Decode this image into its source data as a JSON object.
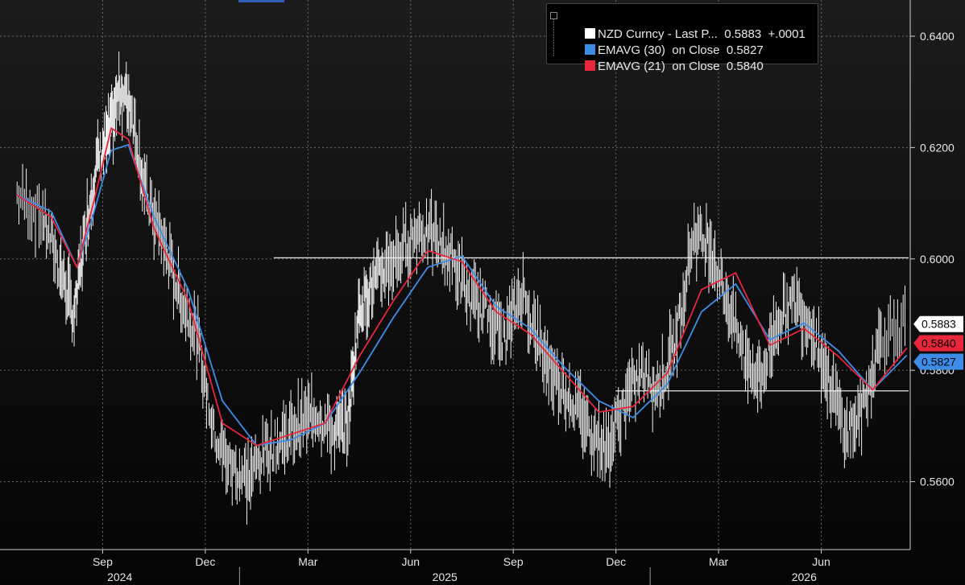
{
  "legend": {
    "rows": [
      {
        "name": "NZD Curncy - Last P...",
        "value": "0.5883",
        "change": "+.0001",
        "color": "#ffffff"
      },
      {
        "name": "EMAVG (30)  on Close",
        "value": "0.5827",
        "change": "",
        "color": "#3d8de8"
      },
      {
        "name": "EMAVG (21)  on Close",
        "value": "0.5840",
        "change": "",
        "color": "#e8263c"
      }
    ]
  },
  "price_tags": [
    {
      "label": "0.5883",
      "bg": "#ffffff",
      "fg": "#000000",
      "value": 0.5883
    },
    {
      "label": "0.5840",
      "bg": "#e8263c",
      "fg": "#000000",
      "value": 0.584
    },
    {
      "label": "0.5827",
      "bg": "#3d8de8",
      "fg": "#000000",
      "value": 0.5827
    }
  ],
  "chart_data": {
    "type": "line",
    "title": "",
    "xlabel": "",
    "ylabel": "",
    "ylim": [
      0.5478,
      0.6465
    ],
    "y_ticks": [
      "0.5600",
      "0.5800",
      "0.6000",
      "0.6200",
      "0.6400"
    ],
    "x_month_ticks": [
      "Sep",
      "Dec",
      "Mar",
      "Jun",
      "Sep",
      "Dec",
      "Mar",
      "Jun"
    ],
    "x_year_labels": [
      "2024",
      "2025",
      "2026"
    ],
    "grid": true,
    "legend_position": "top-right",
    "horizontal_lines": [
      {
        "y": 0.6002,
        "x_from": "2025-02",
        "x_to": "end"
      },
      {
        "y": 0.5763,
        "x_from": "2025-12",
        "x_to": "end"
      }
    ],
    "series": [
      {
        "name": "NZD Curncy - Last P...",
        "color": "#ffffff",
        "style": "high-low bars",
        "x": [
          "2024-06",
          "2024-07",
          "2024-07",
          "2024-08",
          "2024-08",
          "2024-08",
          "2024-09",
          "2024-09",
          "2024-09",
          "2024-10",
          "2024-10",
          "2024-11",
          "2024-11",
          "2024-12",
          "2024-12",
          "2025-01",
          "2025-01",
          "2025-02",
          "2025-02",
          "2025-03",
          "2025-03",
          "2025-04",
          "2025-04",
          "2025-04",
          "2025-05",
          "2025-05",
          "2025-06",
          "2025-06",
          "2025-07",
          "2025-07",
          "2025-08",
          "2025-08",
          "2025-09",
          "2025-09",
          "2025-10",
          "2025-10",
          "2025-11",
          "2025-11",
          "2025-12",
          "2025-12",
          "2026-01",
          "2026-01",
          "2026-02",
          "2026-02",
          "2026-03",
          "2026-03",
          "2026-04",
          "2026-04",
          "2026-05",
          "2026-05",
          "2026-06",
          "2026-06",
          "2026-07",
          "2026-07",
          "2026-08"
        ],
        "values": [
          0.6115,
          0.6075,
          0.5985,
          0.5895,
          0.6055,
          0.6175,
          0.6215,
          0.6305,
          0.6275,
          0.6115,
          0.6035,
          0.5935,
          0.5865,
          0.5685,
          0.5625,
          0.5605,
          0.5655,
          0.5675,
          0.5705,
          0.5725,
          0.5685,
          0.5705,
          0.5915,
          0.5945,
          0.5985,
          0.6015,
          0.6055,
          0.6035,
          0.5995,
          0.5925,
          0.5905,
          0.5855,
          0.5945,
          0.5845,
          0.5785,
          0.5745,
          0.5695,
          0.5655,
          0.5745,
          0.5795,
          0.5765,
          0.5855,
          0.6045,
          0.6025,
          0.5925,
          0.5825,
          0.5785,
          0.5895,
          0.5925,
          0.5875,
          0.5775,
          0.5685,
          0.5735,
          0.5865,
          0.5883
        ]
      },
      {
        "name": "EMAVG (30)  on Close",
        "color": "#3d8de8",
        "x": [
          "2024-06",
          "2024-07",
          "2024-08",
          "2024-08",
          "2024-09",
          "2024-09",
          "2024-10",
          "2024-11",
          "2024-12",
          "2025-01",
          "2025-02",
          "2025-03",
          "2025-04",
          "2025-05",
          "2025-06",
          "2025-07",
          "2025-08",
          "2025-09",
          "2025-10",
          "2025-11",
          "2025-12",
          "2026-01",
          "2026-02",
          "2026-03",
          "2026-04",
          "2026-05",
          "2026-06",
          "2026-07",
          "2026-08"
        ],
        "values": [
          0.6115,
          0.6085,
          0.5985,
          0.6085,
          0.6195,
          0.6205,
          0.6075,
          0.5945,
          0.5745,
          0.5665,
          0.5675,
          0.5705,
          0.5795,
          0.5895,
          0.5985,
          0.6005,
          0.5915,
          0.5875,
          0.5805,
          0.5745,
          0.5715,
          0.5775,
          0.5905,
          0.5955,
          0.5855,
          0.5885,
          0.5835,
          0.5765,
          0.5827
        ]
      },
      {
        "name": "EMAVG (21)  on Close",
        "color": "#e8263c",
        "x": [
          "2024-06",
          "2024-07",
          "2024-08",
          "2024-08",
          "2024-09",
          "2024-09",
          "2024-10",
          "2024-11",
          "2024-12",
          "2025-01",
          "2025-02",
          "2025-03",
          "2025-04",
          "2025-05",
          "2025-06",
          "2025-07",
          "2025-08",
          "2025-09",
          "2025-10",
          "2025-11",
          "2025-12",
          "2026-01",
          "2026-02",
          "2026-03",
          "2026-04",
          "2026-05",
          "2026-06",
          "2026-07",
          "2026-08"
        ],
        "values": [
          0.6115,
          0.6075,
          0.5985,
          0.6105,
          0.6235,
          0.6215,
          0.6055,
          0.5925,
          0.5705,
          0.5665,
          0.5685,
          0.5705,
          0.5825,
          0.5925,
          0.6015,
          0.5995,
          0.5905,
          0.5865,
          0.5795,
          0.5725,
          0.5735,
          0.5795,
          0.5945,
          0.5975,
          0.5845,
          0.5875,
          0.5825,
          0.5765,
          0.584
        ]
      }
    ]
  }
}
